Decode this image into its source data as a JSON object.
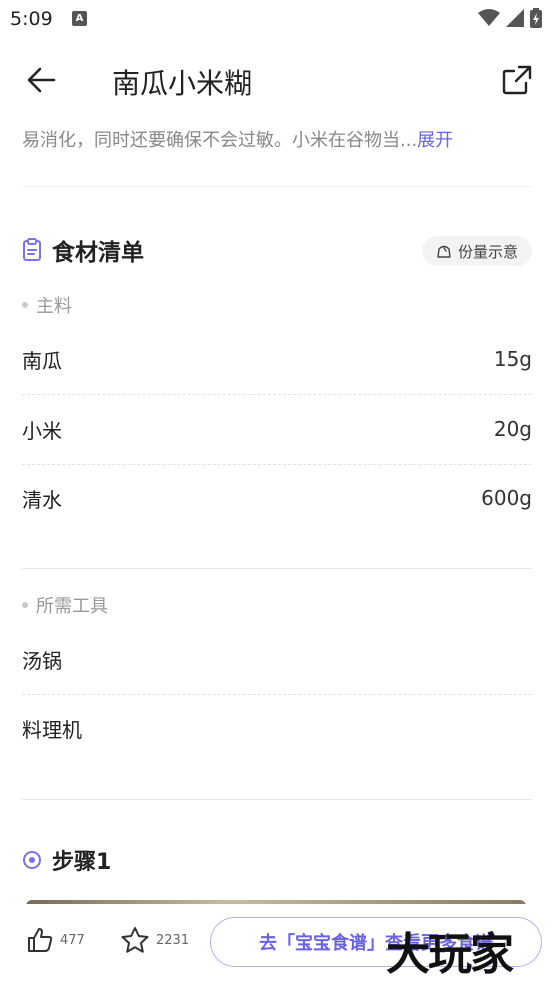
{
  "status": {
    "time": "5:09",
    "notification_icon": "A"
  },
  "header": {
    "title": "南瓜小米糊"
  },
  "description": {
    "text": "易消化，同时还要确保不会过敏。小米在谷物当...",
    "expand_label": "展开"
  },
  "ingredients": {
    "title": "食材清单",
    "portion_label": "份量示意",
    "main_label": "主料",
    "main_items": [
      {
        "name": "南瓜",
        "qty": "15g"
      },
      {
        "name": "小米",
        "qty": "20g"
      },
      {
        "name": "清水",
        "qty": "600g"
      }
    ],
    "tools_label": "所需工具",
    "tools": [
      {
        "name": "汤锅"
      },
      {
        "name": "料理机"
      }
    ]
  },
  "step": {
    "title": "步骤1"
  },
  "bottom": {
    "likes": "477",
    "favorites": "2231",
    "cta_label": "去「宝宝食谱」查看更多食谱"
  },
  "watermark": "大玩家",
  "colors": {
    "accent": "#6a63e0",
    "text": "#222222",
    "muted": "#888888"
  }
}
